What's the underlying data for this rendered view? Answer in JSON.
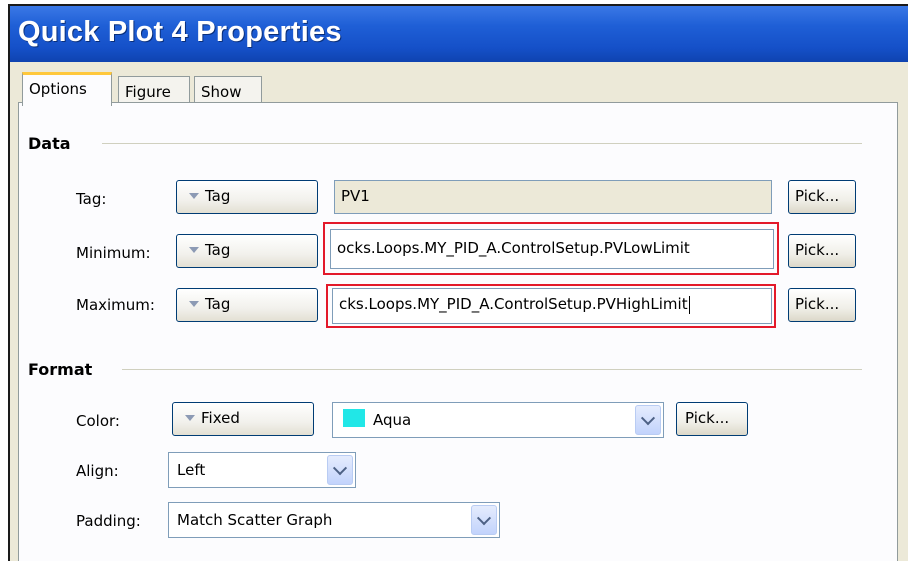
{
  "window": {
    "title": "Quick Plot 4 Properties"
  },
  "tabs": [
    {
      "label": "Options",
      "active": true
    },
    {
      "label": "Figure",
      "active": false
    },
    {
      "label": "Show",
      "active": false
    }
  ],
  "data_section": {
    "heading": "Data",
    "rows": [
      {
        "label": "Tag:",
        "mode": "Tag",
        "value": "PV1",
        "pick": "Pick..."
      },
      {
        "label": "Minimum:",
        "mode": "Tag",
        "value": "ocks.Loops.MY_PID_A.ControlSetup.PVLowLimit",
        "pick": "Pick..."
      },
      {
        "label": "Maximum:",
        "mode": "Tag",
        "value": "cks.Loops.MY_PID_A.ControlSetup.PVHighLimit",
        "pick": "Pick..."
      }
    ]
  },
  "format_section": {
    "heading": "Format",
    "color": {
      "label": "Color:",
      "mode": "Fixed",
      "value": "Aqua",
      "swatch": "#21e7e7",
      "pick": "Pick..."
    },
    "align": {
      "label": "Align:",
      "value": "Left"
    },
    "padding": {
      "label": "Padding:",
      "value": "Match Scatter Graph"
    }
  },
  "colors": {
    "titlebar": "#1f5fd6",
    "highlight": "#e3192a",
    "tab_accent": "#ffc83c"
  }
}
